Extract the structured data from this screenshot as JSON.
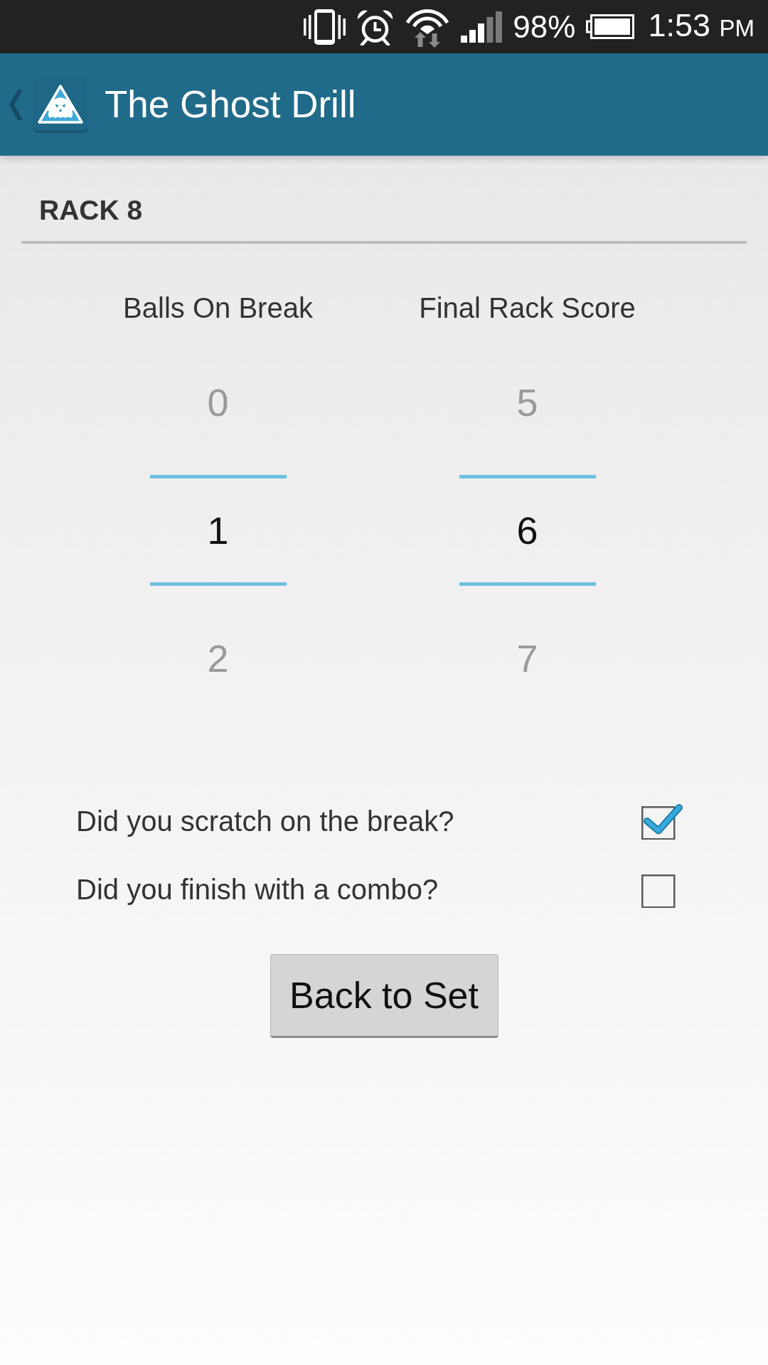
{
  "status_bar": {
    "battery": "98%",
    "time": "1:53",
    "time_period": "PM"
  },
  "app_bar": {
    "title": "The Ghost Drill"
  },
  "section_title": "RACK 8",
  "pickers": [
    {
      "label": "Balls On Break",
      "options": [
        {
          "value": "0",
          "selected": false
        },
        {
          "value": "1",
          "selected": true
        },
        {
          "value": "2",
          "selected": false
        }
      ]
    },
    {
      "label": "Final Rack Score",
      "options": [
        {
          "value": "5",
          "selected": false
        },
        {
          "value": "6",
          "selected": true
        },
        {
          "value": "7",
          "selected": false
        }
      ]
    }
  ],
  "questions": [
    {
      "label": "Did you scratch on the break?",
      "checked": true
    },
    {
      "label": "Did you finish with a combo?",
      "checked": false
    }
  ],
  "button": {
    "label": "Back to Set"
  }
}
